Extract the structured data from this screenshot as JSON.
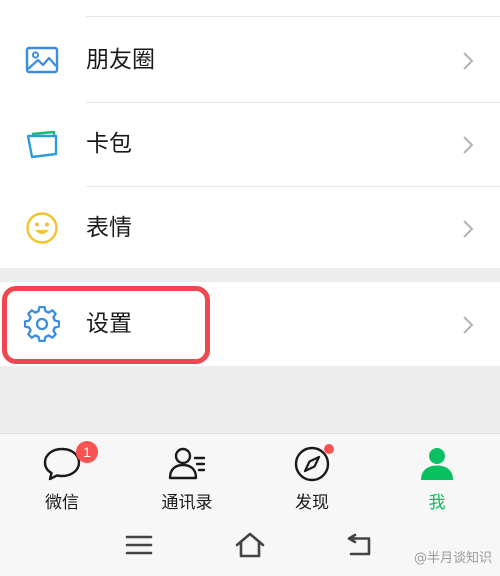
{
  "menu": {
    "items": [
      {
        "label": "朋友圈",
        "icon": "moments-icon"
      },
      {
        "label": "卡包",
        "icon": "card-wallet-icon"
      },
      {
        "label": "表情",
        "icon": "emoji-smile-icon"
      }
    ],
    "settings": {
      "label": "设置",
      "icon": "gear-icon"
    }
  },
  "tabbar": {
    "tabs": [
      {
        "label": "微信",
        "icon": "chat-bubble-icon",
        "badge": "1"
      },
      {
        "label": "通讯录",
        "icon": "contacts-icon"
      },
      {
        "label": "发现",
        "icon": "compass-icon",
        "dot": true
      },
      {
        "label": "我",
        "icon": "person-icon",
        "active": true
      }
    ]
  },
  "navbar": {
    "icons": [
      "menu-icon",
      "home-icon",
      "back-icon"
    ]
  },
  "watermark": "@半月谈知识",
  "colors": {
    "accent": "#07c160",
    "badge": "#fa5151",
    "highlight": "#f0464f",
    "icon_blue": "#3a8de0",
    "icon_yellow": "#f2c230"
  }
}
